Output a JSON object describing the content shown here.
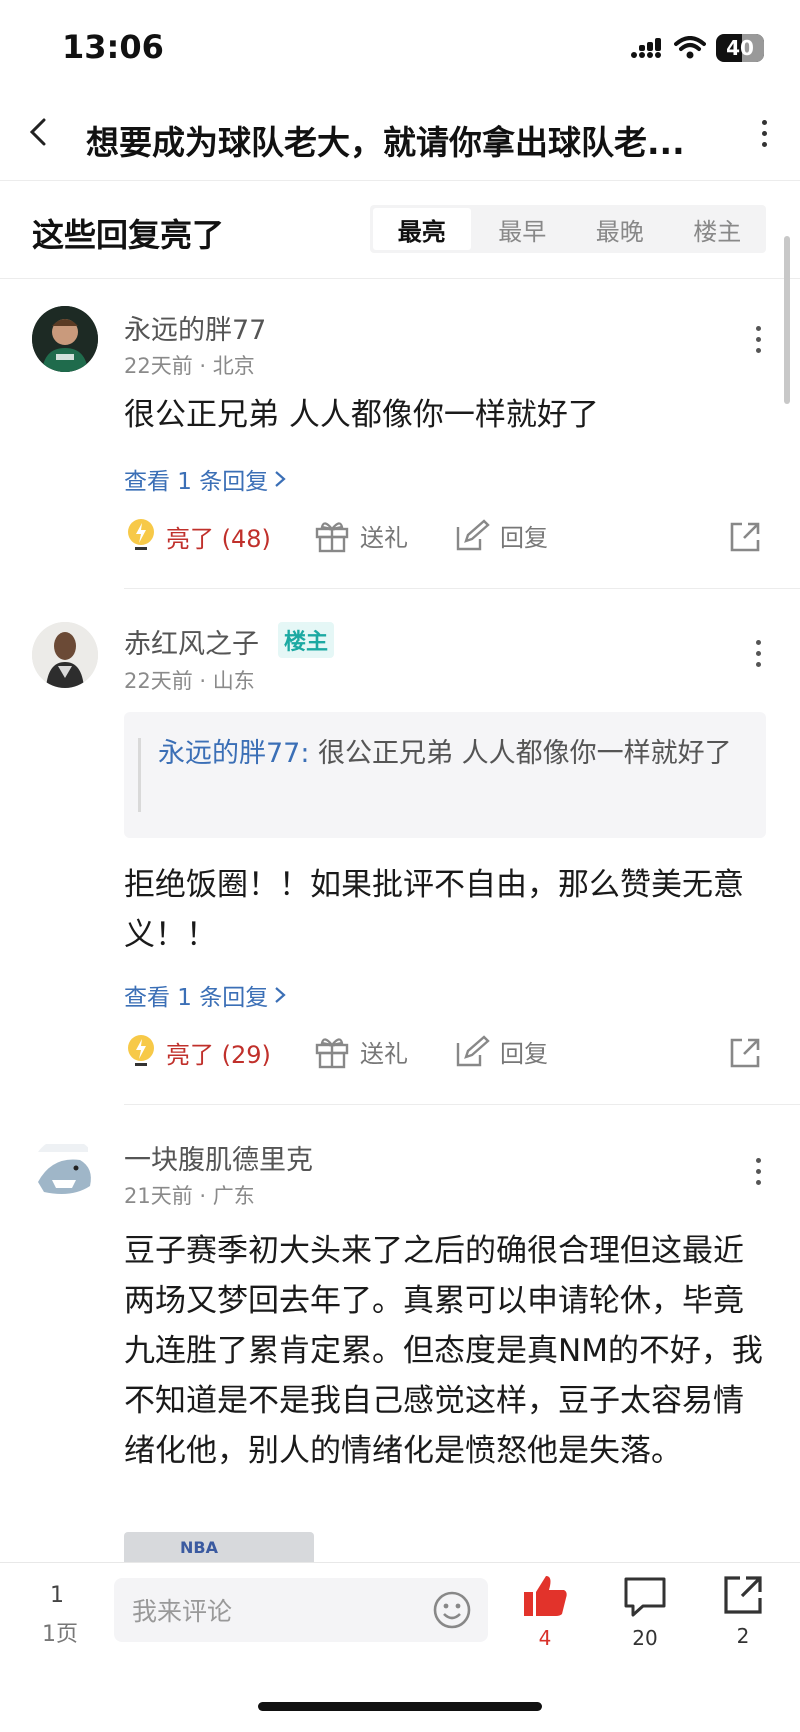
{
  "status_bar": {
    "time": "13:06",
    "battery": "40"
  },
  "header": {
    "title": "想要成为球队老大，就请你拿出球队老..."
  },
  "section": {
    "title": "这些回复亮了",
    "tabs": [
      {
        "label": "最亮",
        "active": true
      },
      {
        "label": "最早",
        "active": false
      },
      {
        "label": "最晚",
        "active": false
      },
      {
        "label": "楼主",
        "active": false
      }
    ]
  },
  "comments": [
    {
      "username": "永远的胖77",
      "meta": "22天前 · 北京",
      "body": "很公正兄弟 人人都像你一样就好了",
      "view_replies": "查看 1 条回复",
      "like_label": "亮了 (48)",
      "gift_label": "送礼",
      "reply_label": "回复"
    },
    {
      "username": "赤红风之子",
      "badge": "楼主",
      "meta": "22天前 · 山东",
      "quote_user": "永远的胖77:",
      "quote_text": " 很公正兄弟 人人都像你一样就好了",
      "body": "拒绝饭圈！！如果批评不自由，那么赞美无意义！！",
      "view_replies": "查看 1 条回复",
      "like_label": "亮了 (29)",
      "gift_label": "送礼",
      "reply_label": "回复"
    },
    {
      "username": "一块腹肌德里克",
      "meta": "21天前 · 广东",
      "body": "豆子赛季初大头来了之后的确很合理但这最近两场又梦回去年了。真累可以申请轮休，毕竟九连胜了累肯定累。但态度是真NM的不好，我不知道是不是我自己感觉这样，豆子太容易情绪化他，别人的情绪化是愤怒他是失落。",
      "image_text": "NBA"
    }
  ],
  "bottom_bar": {
    "page_number": "1",
    "page_label": "1页",
    "input_placeholder": "我来评论",
    "like_count": "4",
    "comment_count": "20",
    "share_count": "2"
  },
  "colors": {
    "accent_blue": "#3b6fb6",
    "lit_red": "#c0302b",
    "owner_teal": "#1ca9a2",
    "like_red": "#e2332b"
  }
}
